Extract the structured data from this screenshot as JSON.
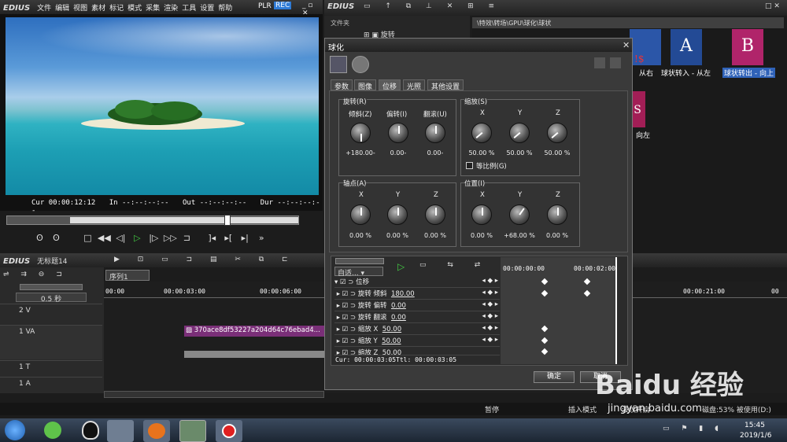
{
  "app": {
    "logo": "EDIUS",
    "menu": [
      "文件",
      "编辑",
      "视图",
      "素材",
      "标记",
      "模式",
      "采集",
      "渲染",
      "工具",
      "设置",
      "帮助"
    ],
    "plr": "PLR",
    "rec": "REC"
  },
  "preview": {
    "cur_label": "Cur",
    "cur": "00:00:12:12",
    "in_label": "In",
    "in": "--:--:--:--",
    "out_label": "Out",
    "out": "--:--:--:--",
    "dur_label": "Dur",
    "dur": "--:--:--:--"
  },
  "bin": {
    "logo": "EDIUS",
    "folder_header": "文件夹",
    "tree_item": "旋转",
    "path": "\\特效\\转场\\GPU\\球化\\球状",
    "fx": [
      {
        "glyph": "A",
        "label": "从右"
      },
      {
        "glyph": "A",
        "label": "球状转入 - 从左"
      },
      {
        "glyph": "B",
        "label": "球状转出 - 向上"
      },
      {
        "glyph": "S",
        "label": "向左"
      }
    ]
  },
  "dialog": {
    "title": "球化",
    "tabs": [
      "参数",
      "图像",
      "位移",
      "光照",
      "其他设置"
    ],
    "rotate": {
      "title": "旋转(R)",
      "knobs": [
        {
          "label": "倾斜(Z)",
          "value": "+180.00-"
        },
        {
          "label": "偏转(I)",
          "value": "0.00-"
        },
        {
          "label": "翻滚(U)",
          "value": "0.00-"
        }
      ]
    },
    "scale": {
      "title": "缩放(S)",
      "knobs": [
        {
          "label": "X",
          "value": "50.00 %"
        },
        {
          "label": "Y",
          "value": "50.00 %"
        },
        {
          "label": "Z",
          "value": "50.00 %"
        }
      ],
      "checkbox": "等比例(G)"
    },
    "pivot": {
      "title": "轴点(A)",
      "knobs": [
        {
          "label": "X",
          "value": "0.00 %"
        },
        {
          "label": "Y",
          "value": "0.00 %"
        },
        {
          "label": "Z",
          "value": "0.00 %"
        }
      ]
    },
    "position": {
      "title": "位置(I)",
      "knobs": [
        {
          "label": "X",
          "value": "0.00 %"
        },
        {
          "label": "Y",
          "value": "+68.00 %"
        },
        {
          "label": "Z",
          "value": "0.00 %"
        }
      ]
    },
    "kf": {
      "mode": "自适...",
      "t0": "00:00:00:00",
      "t1": "00:00:02:00",
      "root": "位移",
      "rows": [
        {
          "name": "旋转 倾斜",
          "value": "180.00"
        },
        {
          "name": "旋转 偏转",
          "value": "0.00"
        },
        {
          "name": "旋转 翻滚",
          "value": "0.00"
        },
        {
          "name": "缩放 X",
          "value": "50.00"
        },
        {
          "name": "缩放 Y",
          "value": "50.00"
        },
        {
          "name": "缩放 Z",
          "value": "50.00"
        }
      ],
      "cur": "Cur: 00:00:03:05",
      "ttl": "Ttl: 00:00:03:05"
    },
    "ok": "确定",
    "cancel": "取消"
  },
  "timeline": {
    "logo": "EDIUS",
    "project": "无标题14",
    "seq": "序列1",
    "zoom": "0.5 秒",
    "ruler": [
      "00:00",
      "00:00:03:00",
      "00:00:06:00",
      "00:00:21:00",
      "00"
    ],
    "tracks": [
      {
        "name": "2 V"
      },
      {
        "name": "1 VA"
      },
      {
        "name": "1 T"
      },
      {
        "name": "1 A"
      }
    ],
    "clip": "370ace8df53227a204d64c76ebad4..."
  },
  "status": {
    "pause": "暂停",
    "insert": "插入模式",
    "ripple": "波纹开启",
    "disk": "磁盘:53% 被使用(D:)"
  },
  "taskbar": {
    "time": "15:45",
    "date": "2019/1/6"
  },
  "watermark": {
    "logo": "Baidu 经验",
    "url": "jingyan.baidu.com"
  }
}
